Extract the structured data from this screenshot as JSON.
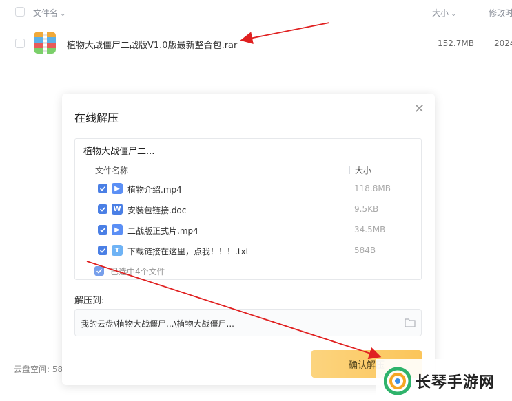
{
  "file_list": {
    "header": {
      "name_label": "文件名",
      "size_label": "大小",
      "modified_label": "修改时"
    },
    "rows": [
      {
        "name": "植物大战僵尸二战版V1.0版最新整合包.rar",
        "size": "152.7MB",
        "date": "2024"
      }
    ]
  },
  "dialog": {
    "title": "在线解压",
    "archive_name": "植物大战僵尸二...",
    "columns": {
      "name": "文件名称",
      "size": "大小"
    },
    "files": [
      {
        "name": "植物介绍.mp4",
        "size": "118.8MB",
        "icon_label": "▶"
      },
      {
        "name": "安装包链接.doc",
        "size": "9.5KB",
        "icon_label": "W"
      },
      {
        "name": "二战版正式片.mp4",
        "size": "34.5MB",
        "icon_label": "▶"
      },
      {
        "name": "下载链接在这里，点我！！！.txt",
        "size": "584B",
        "icon_label": "T"
      }
    ],
    "selected_info": "已选中4个文件",
    "extract_to_label": "解压到:",
    "extract_path": "我的云盘\\植物大战僵尸...\\植物大战僵尸...",
    "confirm_label": "确认解压"
  },
  "footer": {
    "storage_label": "云盘空间: 58"
  },
  "watermark": {
    "text": "长琴手游网"
  },
  "colors": {
    "accent": "#4a7fe5",
    "confirm": "#fbc55a",
    "arrow": "#e02020"
  }
}
